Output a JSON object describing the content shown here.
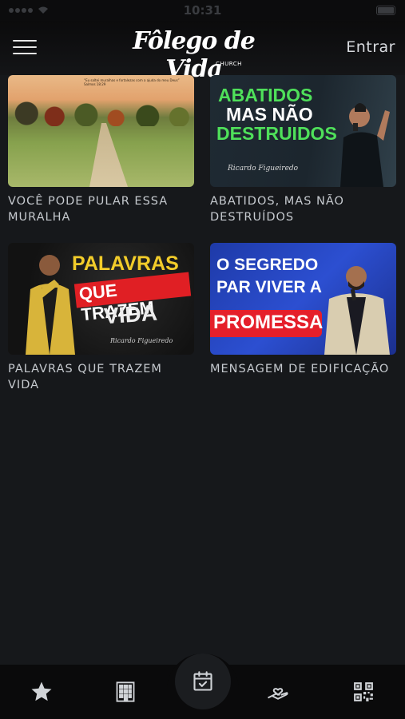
{
  "status_bar": {
    "time": "10:31"
  },
  "header": {
    "logo_text": "Fôlego de Vida",
    "logo_sub": "CHURCH",
    "login_label": "Entrar"
  },
  "videos": [
    {
      "title": "VOCÊ PODE PULAR ESSA MURALHA",
      "thumb_caption": "“Eu saltei muralhas e fortalezas com a ajuda do meu Deus” Salmos 18:29"
    },
    {
      "title": "ABATIDOS, MAS NÃO DESTRUÍDOS",
      "thumb_lines": [
        "ABATIDOS",
        "MAS NÃO",
        "DESTRUIDOS"
      ],
      "thumb_signature": "Ricardo Figueiredo"
    },
    {
      "title": "PALAVRAS QUE TRAZEM VIDA",
      "thumb_lines": [
        "PALAVRAS",
        "QUE TRAZEM",
        "VIDA"
      ],
      "thumb_signature": "Ricardo Figueiredo"
    },
    {
      "title": "MENSAGEM DE EDIFICAÇÃO",
      "thumb_lines": [
        "O SEGREDO",
        "PAR VIVER A",
        "PROMESSA"
      ]
    }
  ],
  "tabbar": {
    "tabs": [
      {
        "icon": "star-icon"
      },
      {
        "icon": "building-icon"
      },
      {
        "icon": "calendar-check-icon",
        "active": true
      },
      {
        "icon": "hand-heart-icon"
      },
      {
        "icon": "qr-code-icon"
      }
    ]
  }
}
